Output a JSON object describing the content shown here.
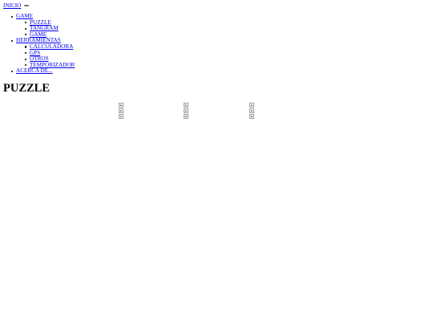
{
  "header": {
    "home_link": "INICIO"
  },
  "nav": {
    "game": {
      "label": "GAME",
      "items": [
        "PUZZLE",
        "TANGRAM",
        "GAME"
      ]
    },
    "tools": {
      "label": "HERRAMIENTAS",
      "items": [
        "CALCULADORA",
        "GPS",
        "OTROS",
        "TEMPORIZADOR"
      ]
    },
    "about": {
      "label": "ACERCA DE..."
    }
  },
  "main": {
    "title": "PUZZLE",
    "pieces": {
      "rows": 3,
      "columns": 3,
      "icon": "broken-image-icon"
    }
  }
}
